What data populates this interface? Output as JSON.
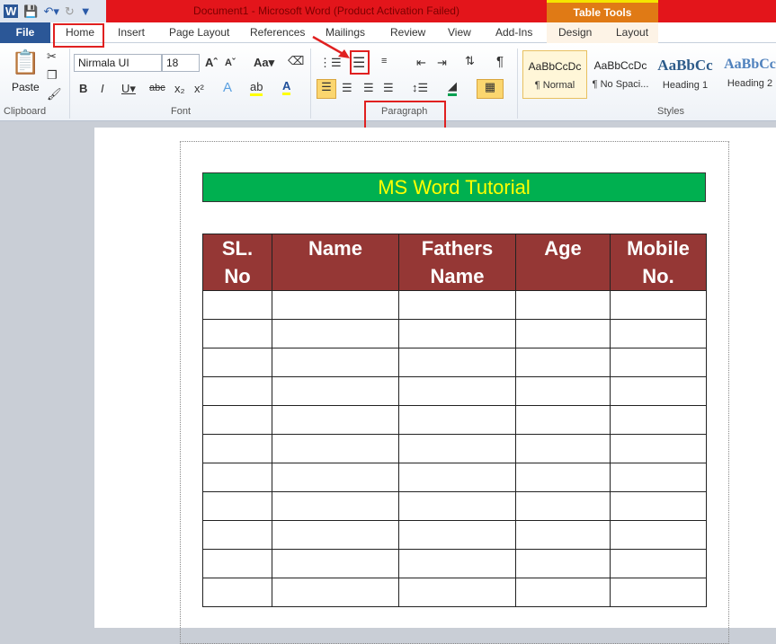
{
  "window": {
    "title": "Document1  -  Microsoft Word (Product Activation Failed)",
    "context_tab_group": "Table Tools"
  },
  "qat": {
    "icons": [
      "word-logo-icon",
      "save-icon",
      "undo-icon",
      "redo-icon",
      "customize-icon"
    ]
  },
  "tabs": [
    {
      "label": "File"
    },
    {
      "label": "Home",
      "selected": true
    },
    {
      "label": "Insert"
    },
    {
      "label": "Page Layout"
    },
    {
      "label": "References"
    },
    {
      "label": "Mailings"
    },
    {
      "label": "Review"
    },
    {
      "label": "View"
    },
    {
      "label": "Add-Ins"
    },
    {
      "label": "Design"
    },
    {
      "label": "Layout"
    }
  ],
  "ribbon": {
    "clipboard": {
      "label": "Clipboard",
      "paste": "Paste"
    },
    "font": {
      "label": "Font",
      "name": "Nirmala UI",
      "size": "18"
    },
    "paragraph": {
      "label": "Paragraph"
    },
    "styles": {
      "label": "Styles",
      "items": [
        {
          "preview": "AaBbCcDc",
          "name": "¶ Normal",
          "color": "#000000"
        },
        {
          "preview": "AaBbCcDc",
          "name": "¶ No Spaci...",
          "color": "#000000"
        },
        {
          "preview": "AaBbCc",
          "name": "Heading 1",
          "color": "#2e5c8a"
        },
        {
          "preview": "AaBbCc",
          "name": "Heading 2",
          "color": "#4f81bd"
        }
      ]
    }
  },
  "document": {
    "banner": "MS Word Tutorial",
    "table": {
      "headers": [
        "SL.\nNo",
        "Name",
        "Fathers\nName",
        "Age",
        "Mobile\nNo."
      ],
      "empty_rows": 11
    },
    "colors": {
      "banner_bg": "#00b050",
      "banner_text": "#ffff00",
      "header_bg": "#953735"
    }
  },
  "annotations": {
    "color": "#e02020",
    "highlighted": [
      "Home tab",
      "Line spacing button",
      "Paragraph group label"
    ]
  }
}
